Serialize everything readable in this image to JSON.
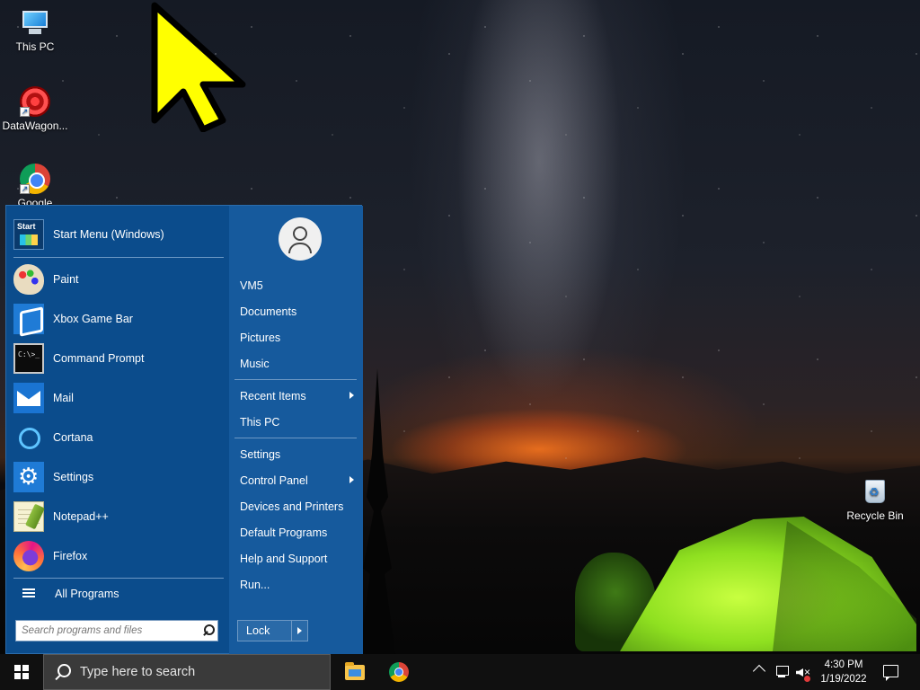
{
  "desktop": {
    "icons": [
      {
        "label": "This PC",
        "icon": "computer-icon"
      },
      {
        "label": "DataWagon...",
        "icon": "datawagon-icon"
      },
      {
        "label": "Google",
        "icon": "chrome-icon"
      },
      {
        "label": "Recycle Bin",
        "icon": "recycle-bin-icon"
      }
    ]
  },
  "start_menu": {
    "programs": [
      {
        "label": "Start Menu (Windows)",
        "icon": "start-menu-icon"
      },
      {
        "label": "Paint",
        "icon": "paint-icon"
      },
      {
        "label": "Xbox Game Bar",
        "icon": "xbox-icon"
      },
      {
        "label": "Command Prompt",
        "icon": "command-prompt-icon"
      },
      {
        "label": "Mail",
        "icon": "mail-icon"
      },
      {
        "label": "Cortana",
        "icon": "cortana-icon"
      },
      {
        "label": "Settings",
        "icon": "settings-gear-icon"
      },
      {
        "label": "Notepad++",
        "icon": "notepad-plus-plus-icon"
      },
      {
        "label": "Firefox",
        "icon": "firefox-icon"
      }
    ],
    "start_icon_text": "Start",
    "cmd_icon_text": "C:\\>_",
    "all_programs_label": "All Programs",
    "search_placeholder": "Search programs and files",
    "right_items": [
      {
        "label": "VM5",
        "submenu": false
      },
      {
        "label": "Documents",
        "submenu": false
      },
      {
        "label": "Pictures",
        "submenu": false
      },
      {
        "label": "Music",
        "submenu": false
      },
      {
        "label": "Recent Items",
        "submenu": true
      },
      {
        "label": "This PC",
        "submenu": false
      },
      {
        "label": "Settings",
        "submenu": false
      },
      {
        "label": "Control Panel",
        "submenu": true
      },
      {
        "label": "Devices and Printers",
        "submenu": false
      },
      {
        "label": "Default Programs",
        "submenu": false
      },
      {
        "label": "Help and Support",
        "submenu": false
      },
      {
        "label": "Run...",
        "submenu": false
      }
    ],
    "lock_label": "Lock"
  },
  "taskbar": {
    "search_placeholder": "Type here to search",
    "apps": [
      {
        "name": "File Explorer",
        "icon": "file-explorer-icon"
      },
      {
        "name": "Google Chrome",
        "icon": "chrome-icon"
      }
    ],
    "clock": {
      "time": "4:30 PM",
      "date": "1/19/2022"
    }
  },
  "colors": {
    "start_menu_bg": "#0b4c8c",
    "start_menu_right_bg": "#165a9d",
    "taskbar_bg": "#101010",
    "cursor": "#ffff00"
  }
}
